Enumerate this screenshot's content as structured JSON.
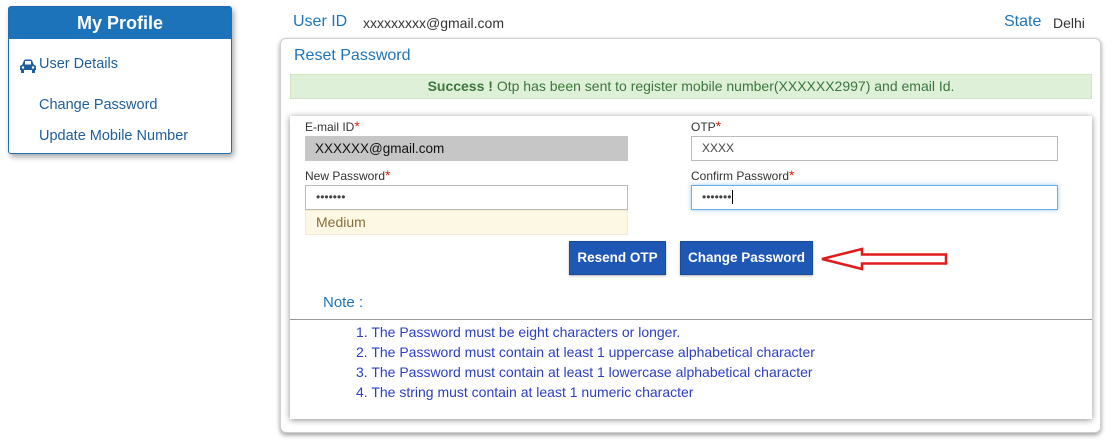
{
  "sidebar": {
    "title": "My Profile",
    "items": [
      {
        "label": "User Details",
        "icon": "car-icon"
      },
      {
        "label": "Change Password"
      },
      {
        "label": "Update Mobile Number"
      }
    ]
  },
  "header": {
    "user_id_label": "User ID",
    "user_id_value": "xxxxxxxxx@gmail.com",
    "state_label": "State",
    "state_value": "Delhi"
  },
  "panel": {
    "title": "Reset Password",
    "alert": {
      "strong": "Success !",
      "message": " Otp has been sent to register mobile number(XXXXXX2997) and email Id."
    },
    "form": {
      "email_label": "E-mail ID",
      "email_value": "XXXXXX@gmail.com",
      "otp_label": "OTP",
      "otp_value": "XXXX",
      "new_password_label": "New Password",
      "new_password_value": "•••••••",
      "confirm_password_label": "Confirm Password",
      "confirm_password_value": "•••••••",
      "required_mark": "*",
      "strength": "Medium"
    },
    "buttons": {
      "resend_otp": "Resend OTP",
      "change_password": "Change Password"
    },
    "note": {
      "title": "Note :",
      "rules": [
        "1. The Password must be eight characters or longer.",
        "2. The Password must contain at least 1 uppercase alphabetical character",
        "3. The Password must contain at least 1 lowercase alphabetical character",
        "4. The string must contain at least 1 numeric character"
      ]
    }
  },
  "colors": {
    "primary": "#1c73b9",
    "button": "#1f57b4",
    "success_bg": "#dff0d8",
    "success_text": "#3c763d",
    "warning_bg": "#fcf8e3",
    "warning_text": "#8a6d3b",
    "required": "#d9230f",
    "annotation_arrow": "#e01b1b",
    "rules_text": "#2a3fc6"
  }
}
